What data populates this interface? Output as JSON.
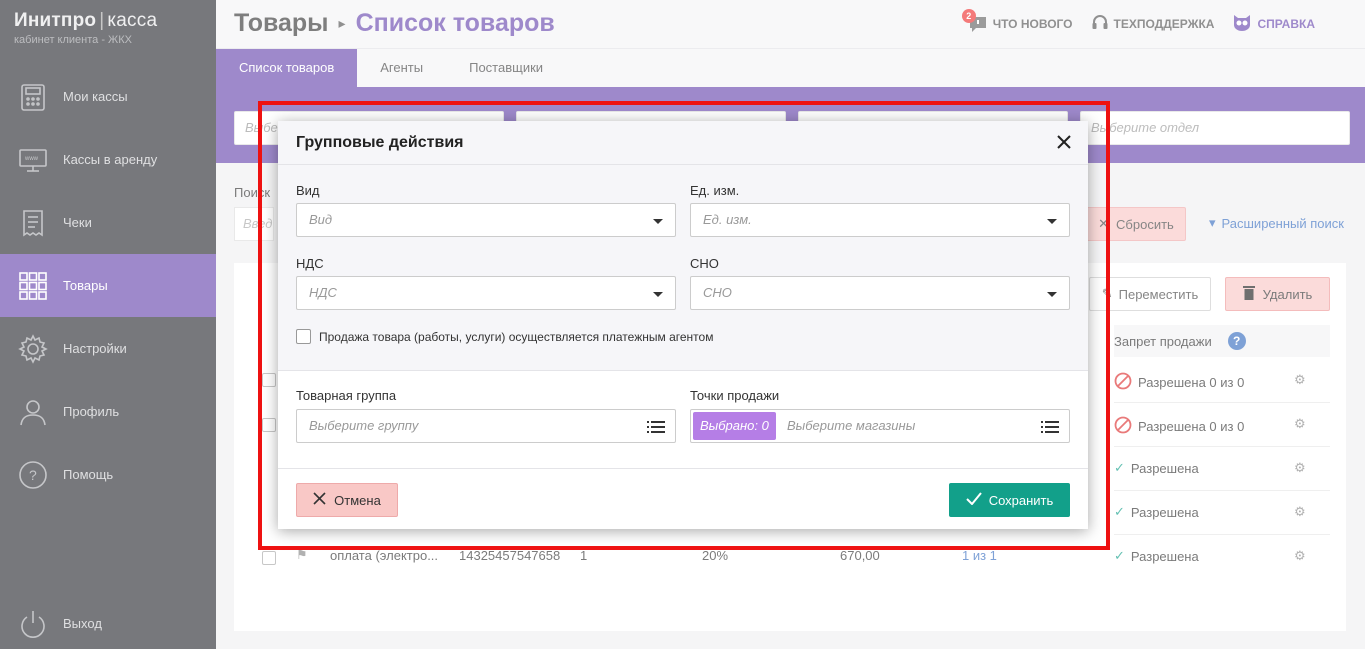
{
  "brand": {
    "name_bold": "Инитпро",
    "name_light": "касса",
    "subtitle": "кабинет клиента - ЖКХ"
  },
  "sidebar": {
    "items": [
      {
        "label": "Мои кассы",
        "icon": "cash-register-icon"
      },
      {
        "label": "Кассы в аренду",
        "icon": "monitor-icon"
      },
      {
        "label": "Чеки",
        "icon": "receipt-icon"
      },
      {
        "label": "Товары",
        "icon": "grid-icon",
        "active": true
      },
      {
        "label": "Настройки",
        "icon": "gear-icon"
      },
      {
        "label": "Профиль",
        "icon": "user-icon"
      },
      {
        "label": "Помощь",
        "icon": "question-icon"
      }
    ],
    "logout": "Выход"
  },
  "header": {
    "breadcrumb_root": "Товары",
    "breadcrumb_current": "Список товаров",
    "whats_new": "ЧТО НОВОГО",
    "whats_new_badge": "2",
    "support": "ТЕХПОДДЕРЖКА",
    "help": "СПРАВКА"
  },
  "tabs": [
    "Список товаров",
    "Агенты",
    "Поставщики"
  ],
  "filters": {
    "department_placeholder": "Выберите отдел",
    "left_placeholder": "Выбе"
  },
  "search": {
    "label": "Поиск",
    "placeholder": "Введ",
    "reset": "Сбросить",
    "advanced": "Расширенный поиск"
  },
  "table": {
    "move": "Переместить",
    "delete": "Удалить",
    "column_sale_ban": "Запрет продажи",
    "rows": [
      {
        "status": "Разрешена 0 из 0",
        "kind": "banned"
      },
      {
        "status": "Разрешена 0 из 0",
        "kind": "banned"
      },
      {
        "status": "Разрешена",
        "kind": "ok"
      },
      {
        "status": "Разрешена",
        "kind": "ok"
      },
      {
        "status": "Разрешена",
        "kind": "ok"
      }
    ],
    "last_row": {
      "name": "оплата (электро...",
      "code": "14325457547658",
      "qty": "1",
      "vat": "20%",
      "price": "670,00",
      "points": "1 из 1"
    }
  },
  "modal": {
    "title": "Групповые действия",
    "kind_label": "Вид",
    "kind_placeholder": "Вид",
    "unit_label": "Ед. изм.",
    "unit_placeholder": "Ед. изм.",
    "vat_label": "НДС",
    "vat_placeholder": "НДС",
    "sno_label": "СНО",
    "sno_placeholder": "СНО",
    "agent_checkbox": "Продажа товара (работы, услуги) осуществляется платежным агентом",
    "group_label": "Товарная группа",
    "group_placeholder": "Выберите группу",
    "points_label": "Точки продажи",
    "points_chip": "Выбрано: 0",
    "points_placeholder": "Выберите магазины",
    "cancel": "Отмена",
    "save": "Сохранить"
  },
  "colors": {
    "accent": "#6a4bb0",
    "save": "#12a08a",
    "danger_bg": "#f9c8c6",
    "highlight": "#ee1111"
  }
}
